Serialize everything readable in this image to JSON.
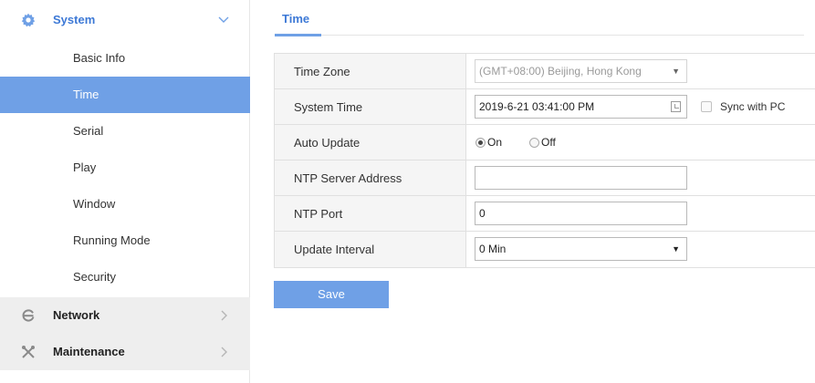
{
  "sidebar": {
    "system": {
      "label": "System",
      "icon": "gear-icon",
      "expanded": true
    },
    "items": [
      {
        "label": "Basic Info",
        "active": false
      },
      {
        "label": "Time",
        "active": true
      },
      {
        "label": "Serial",
        "active": false
      },
      {
        "label": "Play",
        "active": false
      },
      {
        "label": "Window",
        "active": false
      },
      {
        "label": "Running Mode",
        "active": false
      },
      {
        "label": "Security",
        "active": false
      }
    ],
    "network": {
      "label": "Network",
      "icon": "network-icon"
    },
    "maintenance": {
      "label": "Maintenance",
      "icon": "tools-icon"
    }
  },
  "tab": {
    "label": "Time"
  },
  "form": {
    "time_zone": {
      "label": "Time Zone",
      "value": "(GMT+08:00) Beijing, Hong Kong"
    },
    "system_time": {
      "label": "System Time",
      "value": "2019-6-21 03:41:00 PM",
      "sync_label": "Sync with PC"
    },
    "auto_update": {
      "label": "Auto Update",
      "options": [
        "On",
        "Off"
      ],
      "selected": "On"
    },
    "ntp_server": {
      "label": "NTP Server Address",
      "value": ""
    },
    "ntp_port": {
      "label": "NTP Port",
      "value": "0"
    },
    "update_interval": {
      "label": "Update Interval",
      "value": "0 Min"
    }
  },
  "save_label": "Save",
  "colors": {
    "accent": "#6fa0e6",
    "accent_text": "#3d79d6",
    "sidebar_collapsed_bg": "#eeeeee",
    "key_cell_bg": "#f5f5f5"
  }
}
